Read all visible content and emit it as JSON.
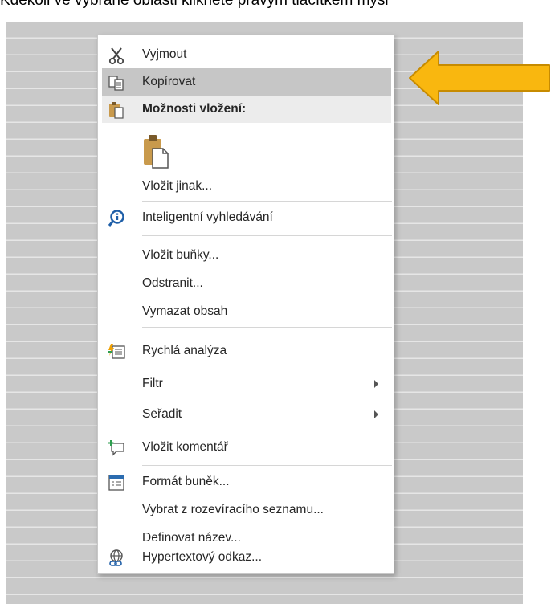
{
  "caption": "Kdekoli ve vybrané oblasti klikněte pravým tlačítkem myši",
  "menu": {
    "cut": "Vyjmout",
    "copy": "Kopírovat",
    "paste_header": "Možnosti vložení:",
    "paste_special": "Vložit jinak...",
    "smart_lookup": "Inteligentní vyhledávání",
    "insert_cells": "Vložit buňky...",
    "delete": "Odstranit...",
    "clear_contents": "Vymazat obsah",
    "quick_analysis": "Rychlá analýza",
    "filter": "Filtr",
    "sort": "Seřadit",
    "insert_comment": "Vložit komentář",
    "format_cells": "Formát buněk...",
    "pick_from_list": "Vybrat z rozevíracího seznamu...",
    "define_name": "Definovat název...",
    "hyperlink": "Hypertextový odkaz..."
  },
  "icons": {
    "cut": "scissors-icon",
    "copy": "copy-icon",
    "paste": "clipboard-icon",
    "smart_lookup": "smart-lookup-icon",
    "quick_analysis": "quick-analysis-icon",
    "comment": "new-comment-icon",
    "format_cells": "format-cells-icon",
    "hyperlink": "hyperlink-icon"
  },
  "colors": {
    "highlight": "#c6c6c6",
    "header_bg": "#ececec",
    "arrow": "#f9b70f",
    "arrow_outline": "#c78b00"
  }
}
